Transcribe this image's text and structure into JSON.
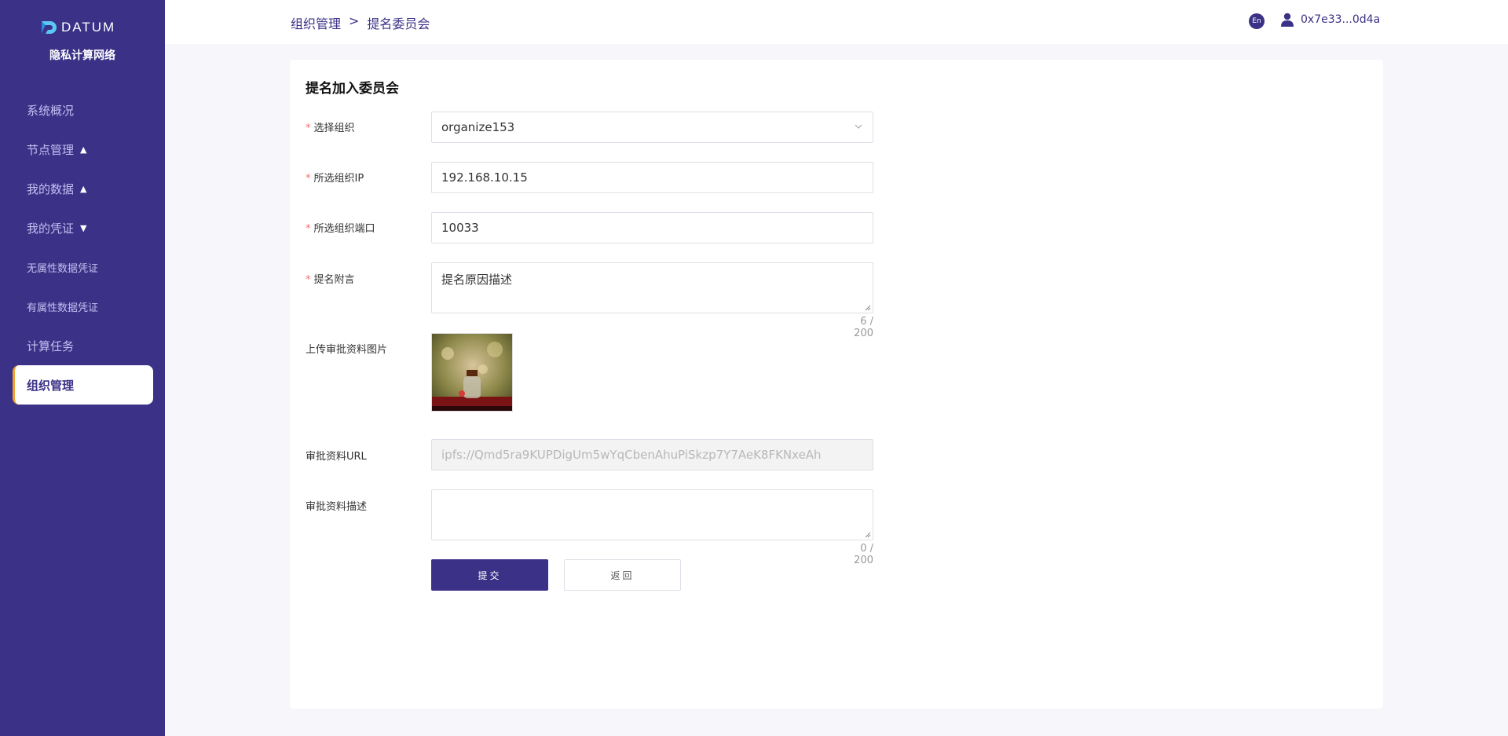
{
  "brand": {
    "logo_text": "DATUM",
    "subtitle": "隐私计算网络"
  },
  "sidebar": {
    "items": [
      {
        "label": "系统概况",
        "caret": ""
      },
      {
        "label": "节点管理",
        "caret": "▲"
      },
      {
        "label": "我的数据",
        "caret": "▲"
      },
      {
        "label": "我的凭证",
        "caret": "▼"
      },
      {
        "label": "无属性数据凭证",
        "caret": ""
      },
      {
        "label": "有属性数据凭证",
        "caret": ""
      },
      {
        "label": "计算任务",
        "caret": ""
      },
      {
        "label": "组织管理",
        "caret": ""
      }
    ],
    "active_index": 7
  },
  "header": {
    "breadcrumb": [
      "组织管理",
      ">",
      "提名委员会"
    ],
    "lang": "En",
    "account": "0x7e33...0d4a"
  },
  "form": {
    "title": "提名加入委员会",
    "org_label": "选择组织",
    "org_value": "organize153",
    "ip_label": "所选组织IP",
    "ip_value": "192.168.10.15",
    "port_label": "所选组织端口",
    "port_value": "10033",
    "remark_label": "提名附言",
    "remark_value": "提名原因描述",
    "remark_count": "6 / 200",
    "upload_label": "上传审批资料图片",
    "url_label": "审批资料URL",
    "url_placeholder": "ipfs://Qmd5ra9KUPDigUm5wYqCbenAhuPiSkzp7Y7AeK8FKNxeAh",
    "desc_label": "审批资料描述",
    "desc_value": "",
    "desc_count": "0 / 200",
    "submit_label": "提交",
    "back_label": "返回"
  },
  "colors": {
    "brand": "#3b3187",
    "accent": "#f2a230",
    "required": "#f56c6c"
  }
}
